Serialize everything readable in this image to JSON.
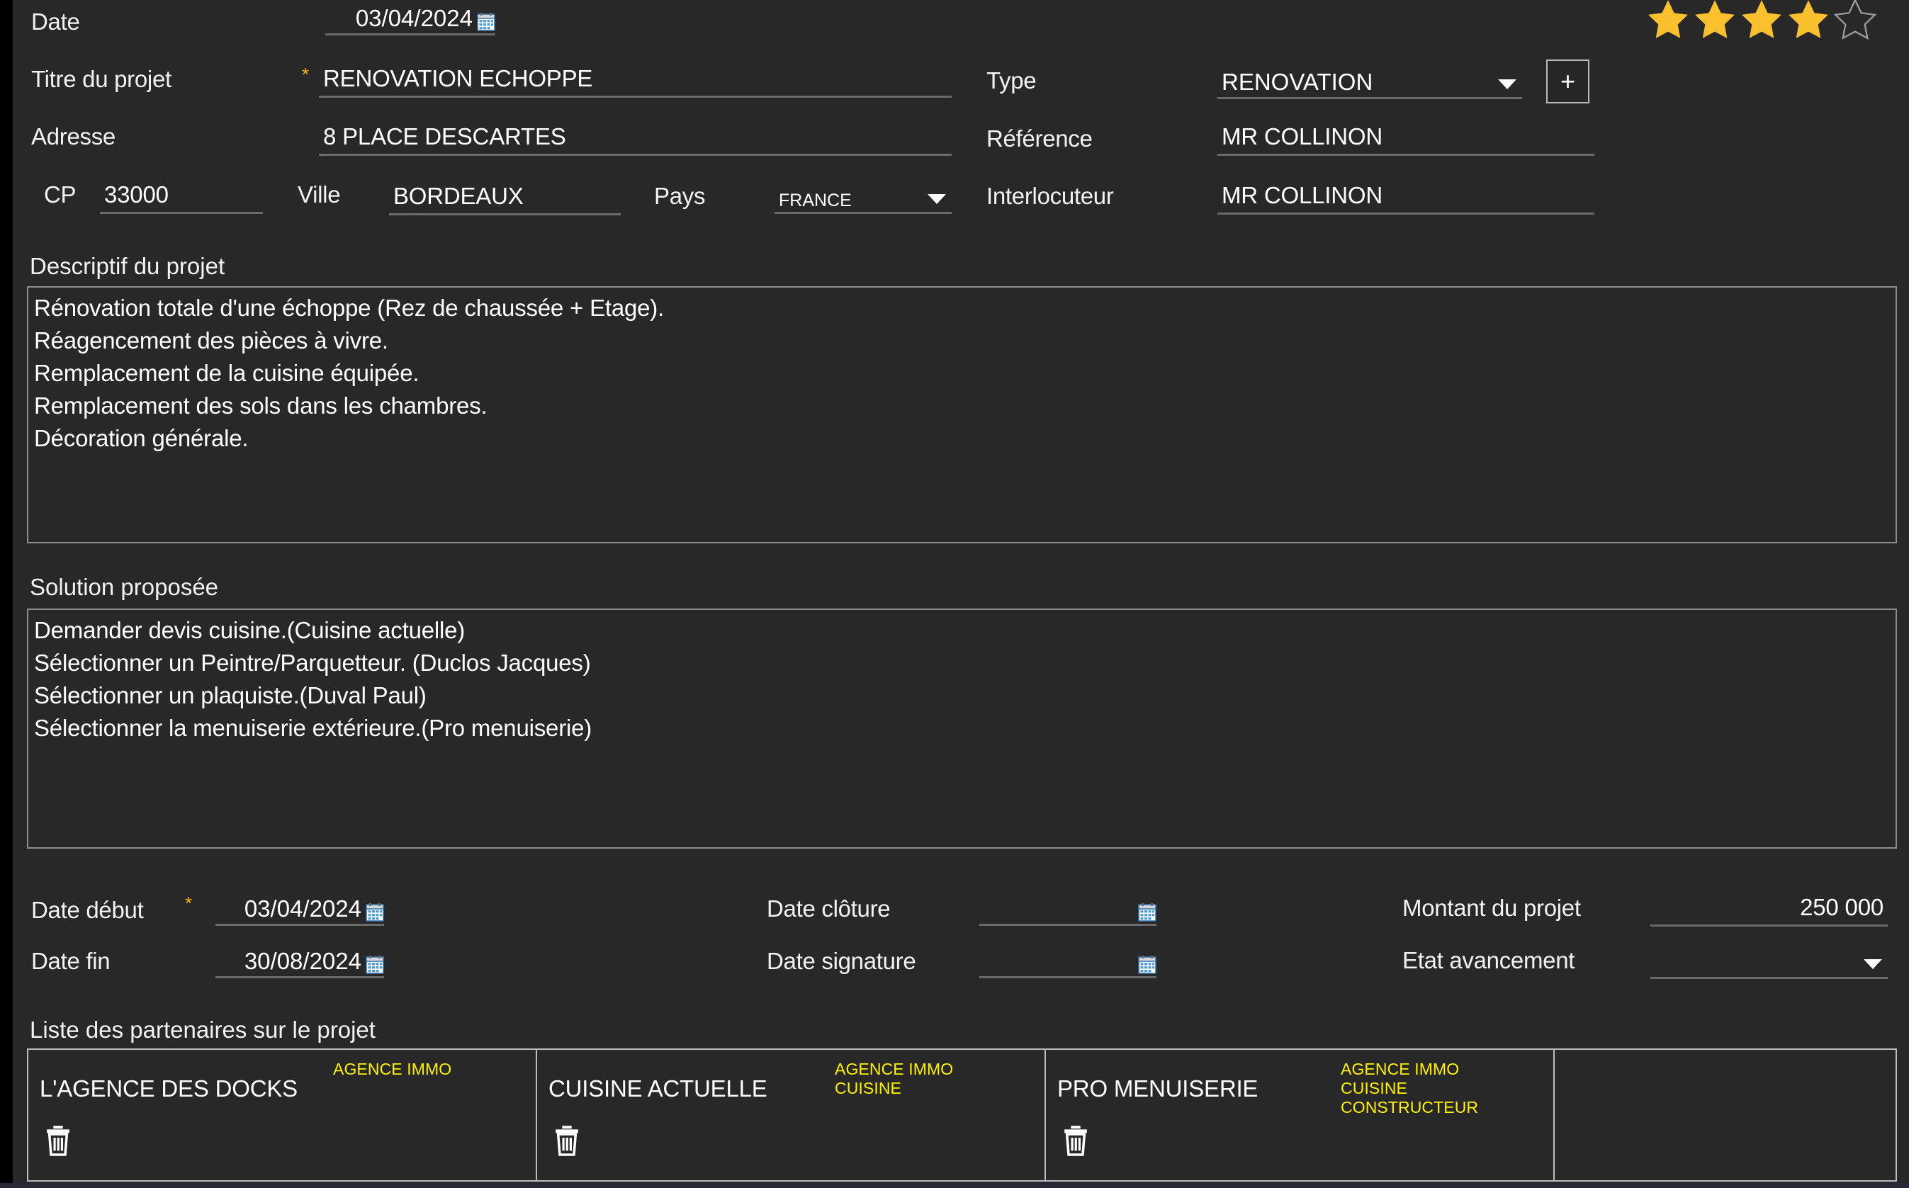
{
  "colors": {
    "background": "#282828",
    "text": "#ffffff",
    "underline": "#6a6a6a",
    "border": "#8d8d8d",
    "star_filled": "#fbc02d",
    "star_empty": "#9b9b9b",
    "required_marker": "#f0b400",
    "tag_yellow": "#fff200"
  },
  "rating": {
    "value": 4,
    "max": 5
  },
  "form": {
    "date": {
      "label": "Date",
      "value": "03/04/2024",
      "icon": "calendar-icon",
      "placeholder": ""
    },
    "titre": {
      "label": "Titre du projet",
      "value": "RENOVATION ECHOPPE",
      "required_marker": "*",
      "placeholder": ""
    },
    "adresse": {
      "label": "Adresse",
      "value": "8 PLACE DESCARTES",
      "placeholder": ""
    },
    "cp": {
      "label": "CP",
      "value": "33000",
      "placeholder": ""
    },
    "ville": {
      "label": "Ville",
      "value": "BORDEAUX",
      "placeholder": ""
    },
    "pays": {
      "label": "Pays",
      "value": "FRANCE",
      "icon": "chevron-down-icon"
    },
    "type": {
      "label": "Type",
      "value": "RENOVATION",
      "icon": "chevron-down-icon",
      "add_button": "+"
    },
    "reference": {
      "label": "Référence",
      "value": "MR COLLINON",
      "placeholder": ""
    },
    "interlocuteur": {
      "label": "Interlocuteur",
      "value": "MR COLLINON",
      "placeholder": ""
    },
    "descriptif": {
      "label": "Descriptif du projet",
      "value": "Rénovation totale d'une échoppe (Rez de chaussée + Etage).\nRéagencement des pièces à vivre.\nRemplacement de la cuisine équipée.\nRemplacement des sols dans les chambres.\nDécoration générale."
    },
    "solution": {
      "label": "Solution proposée",
      "value": "Demander devis cuisine.(Cuisine actuelle)\nSélectionner un Peintre/Parquetteur. (Duclos Jacques)\nSélectionner un plaquiste.(Duval Paul)\nSélectionner la menuiserie extérieure.(Pro menuiserie)"
    },
    "date_debut": {
      "label": "Date début",
      "value": "03/04/2024",
      "required_marker": "*",
      "icon": "calendar-icon"
    },
    "date_fin": {
      "label": "Date fin",
      "value": "30/08/2024",
      "icon": "calendar-icon"
    },
    "date_cloture": {
      "label": "Date clôture",
      "value": "",
      "icon": "calendar-icon"
    },
    "date_signature": {
      "label": "Date signature",
      "value": "",
      "icon": "calendar-icon"
    },
    "montant": {
      "label": "Montant du projet",
      "value": "250 000",
      "placeholder": ""
    },
    "etat_avancement": {
      "label": "Etat avancement",
      "value": "",
      "icon": "chevron-down-icon"
    }
  },
  "partners": {
    "label": "Liste des partenaires sur le projet",
    "items": [
      {
        "name": "L'AGENCE DES DOCKS",
        "tags": [
          "AGENCE IMMO"
        ],
        "delete_icon": "trash-icon"
      },
      {
        "name": "CUISINE ACTUELLE",
        "tags": [
          "AGENCE IMMO",
          "CUISINE"
        ],
        "delete_icon": "trash-icon"
      },
      {
        "name": "PRO MENUISERIE",
        "tags": [
          "AGENCE IMMO",
          "CUISINE",
          "CONSTRUCTEUR"
        ],
        "delete_icon": "trash-icon"
      },
      {
        "name": "",
        "tags": [],
        "delete_icon": ""
      }
    ]
  }
}
